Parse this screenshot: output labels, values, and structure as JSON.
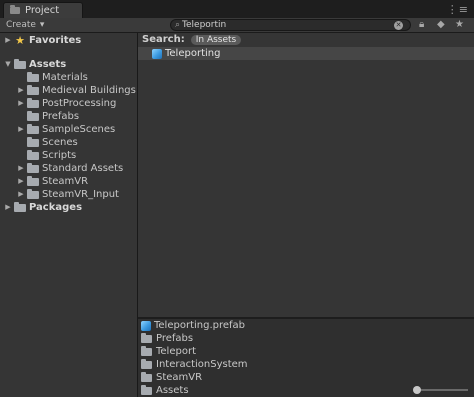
{
  "window": {
    "tab_label": "Project",
    "menu_glyph": "⋮≡"
  },
  "toolbar": {
    "create_label": "Create",
    "create_arrow": "▾",
    "search_value": "Teleportin",
    "search_placeholder": "",
    "icons": [
      "lock-icon",
      "tag-icon",
      "star-icon"
    ]
  },
  "tree": {
    "favorites": {
      "label": "Favorites",
      "expanded": false
    },
    "assets": {
      "label": "Assets",
      "expanded": true,
      "children": [
        {
          "label": "Materials",
          "has_children": false
        },
        {
          "label": "Medieval Buildings",
          "has_children": true
        },
        {
          "label": "PostProcessing",
          "has_children": true
        },
        {
          "label": "Prefabs",
          "has_children": false
        },
        {
          "label": "SampleScenes",
          "has_children": true
        },
        {
          "label": "Scenes",
          "has_children": false
        },
        {
          "label": "Scripts",
          "has_children": false
        },
        {
          "label": "Standard Assets",
          "has_children": true
        },
        {
          "label": "SteamVR",
          "has_children": true
        },
        {
          "label": "SteamVR_Input",
          "has_children": true
        }
      ]
    },
    "packages": {
      "label": "Packages",
      "expanded": false
    }
  },
  "results": {
    "search_label": "Search:",
    "scope": "In Assets",
    "items": [
      {
        "label": "Teleporting",
        "icon": "prefab-cube-icon"
      }
    ]
  },
  "path_panel": {
    "items": [
      {
        "label": "Teleporting.prefab",
        "icon": "prefab-cube-icon"
      },
      {
        "label": "Prefabs",
        "icon": "folder-icon"
      },
      {
        "label": "Teleport",
        "icon": "folder-icon"
      },
      {
        "label": "InteractionSystem",
        "icon": "folder-icon"
      },
      {
        "label": "SteamVR",
        "icon": "folder-icon"
      },
      {
        "label": "Assets",
        "icon": "folder-icon"
      }
    ]
  }
}
